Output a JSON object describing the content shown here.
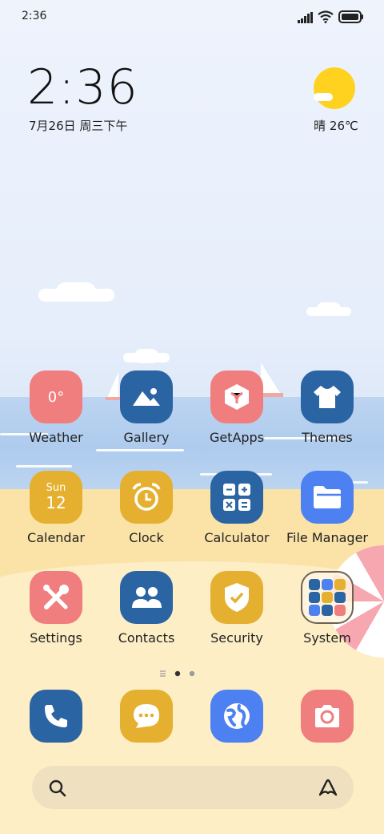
{
  "status_bar": {
    "time": "2:36"
  },
  "widget": {
    "time": "2:36",
    "date": "7月26日 周三下午",
    "weather": "晴 26℃"
  },
  "apps": [
    {
      "label": "Weather",
      "icon": "weather-icon",
      "text": "0°"
    },
    {
      "label": "Gallery",
      "icon": "gallery-icon"
    },
    {
      "label": "GetApps",
      "icon": "getapps-icon"
    },
    {
      "label": "Themes",
      "icon": "themes-icon"
    },
    {
      "label": "Calendar",
      "icon": "calendar-icon",
      "day": "Sun",
      "date": "12"
    },
    {
      "label": "Clock",
      "icon": "alarm-clock-icon"
    },
    {
      "label": "Calculator",
      "icon": "calculator-icon"
    },
    {
      "label": "File Manager",
      "icon": "folder-icon"
    },
    {
      "label": "Settings",
      "icon": "tools-icon"
    },
    {
      "label": "Contacts",
      "icon": "contacts-icon"
    },
    {
      "label": "Security",
      "icon": "shield-icon"
    },
    {
      "label": "System",
      "icon": "system-folder-icon"
    }
  ],
  "dock": [
    {
      "icon": "phone-icon"
    },
    {
      "icon": "messages-icon"
    },
    {
      "icon": "browser-icon"
    },
    {
      "icon": "camera-icon"
    }
  ],
  "page_indicator": {
    "pages": 2,
    "current": 1
  },
  "colors": {
    "red": "#f07e7e",
    "blue": "#2b64a3",
    "yellow": "#e5b030",
    "bright_blue": "#4d80f0",
    "sun": "#ffd21f"
  }
}
